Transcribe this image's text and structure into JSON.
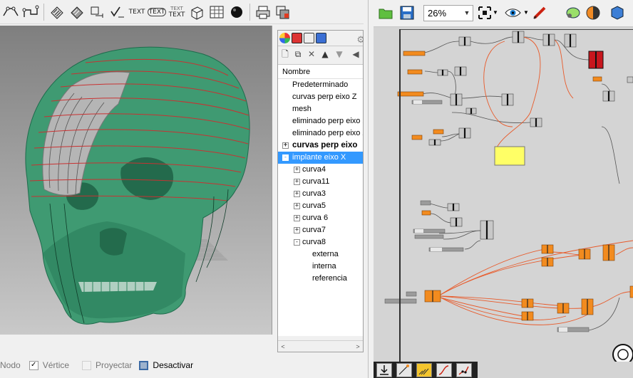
{
  "rhino_toolbar": {
    "icons": [
      "curve-from-point-icon",
      "curve-network-icon",
      "hatch-icon",
      "hatch-pattern-icon",
      "measure-icon",
      "check-icon",
      "text-icon",
      "text-dot-icon",
      "text-object-icon",
      "box-icon",
      "grid-icon",
      "sphere-icon",
      "print-icon",
      "layout-icon"
    ],
    "text_labels": {
      "text1": "TEXT",
      "text2": "TEXT",
      "text3_top": "TEXT",
      "text3_bottom": "TEXT"
    }
  },
  "statusbar": {
    "items": [
      {
        "label": "Nodo",
        "checked": false,
        "enabled": false
      },
      {
        "label": "Vértice",
        "checked": true,
        "enabled": false
      },
      {
        "label": "Proyectar",
        "checked": false,
        "enabled": false
      },
      {
        "label": "Desactivar",
        "checked": false,
        "enabled": true
      }
    ]
  },
  "layers_panel": {
    "header": "Nombre",
    "rows": [
      {
        "label": "Predeterminado",
        "indent": 0,
        "expander": ""
      },
      {
        "label": "curvas perp eixo Z",
        "indent": 0,
        "expander": ""
      },
      {
        "label": "mesh",
        "indent": 0,
        "expander": ""
      },
      {
        "label": "eliminado perp eixo X",
        "indent": 0,
        "expander": ""
      },
      {
        "label": "eliminado perp eixo Z",
        "indent": 0,
        "expander": ""
      },
      {
        "label": "curvas perp eixo",
        "indent": 0,
        "expander": "+",
        "bold": true
      },
      {
        "label": "implante eixo X",
        "indent": 0,
        "expander": "-",
        "selected": true
      },
      {
        "label": "curva4",
        "indent": 1,
        "expander": "+"
      },
      {
        "label": "curva11",
        "indent": 1,
        "expander": "+"
      },
      {
        "label": "curva3",
        "indent": 1,
        "expander": "+"
      },
      {
        "label": "curva5",
        "indent": 1,
        "expander": "+"
      },
      {
        "label": "curva 6",
        "indent": 1,
        "expander": "+"
      },
      {
        "label": "curva7",
        "indent": 1,
        "expander": "+"
      },
      {
        "label": "curva8",
        "indent": 1,
        "expander": "-"
      },
      {
        "label": "externa",
        "indent": 2,
        "expander": ""
      },
      {
        "label": "interna",
        "indent": 2,
        "expander": ""
      },
      {
        "label": "referencia",
        "indent": 2,
        "expander": ""
      }
    ],
    "scroll_left": "<",
    "scroll_right": ">"
  },
  "grasshopper": {
    "zoom": "26%",
    "toolbar_icons": [
      "open-file-icon",
      "save-file-icon",
      "zoom-extents-icon",
      "preview-eye-icon",
      "sketch-icon",
      "bake-icon",
      "shaded-preview-icon",
      "material-icon"
    ],
    "bottom_icons": [
      "download-icon",
      "wire-pointer-icon",
      "wire-default-icon",
      "wire-curve-icon",
      "wire-polyline-icon"
    ],
    "colors": {
      "canvas": "#d4d4d4",
      "component_orange": "#f28b1f",
      "component_grey": "#7a7a7a",
      "wire_red": "#e85a2a",
      "panel_yellow": "#ffff66",
      "error_red": "#c8161d"
    }
  },
  "viewport": {
    "colors": {
      "skull": "#3f9a72",
      "skull_dark": "#1e6b4c",
      "implant": "#b5b5b5",
      "curves": "#c83232",
      "background_top": "#7f7f7f",
      "background_bottom": "#c9c9c9"
    }
  }
}
